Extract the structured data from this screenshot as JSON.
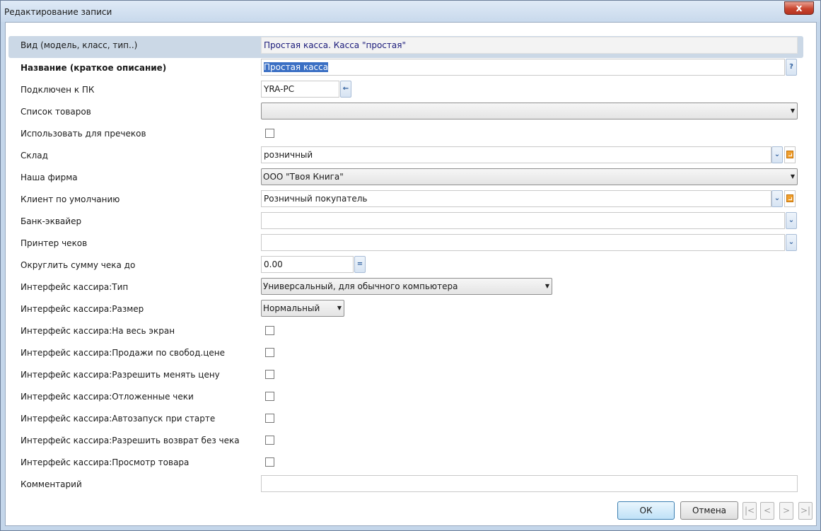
{
  "window": {
    "title": "Редактирование записи",
    "close_symbol": "x"
  },
  "fields": {
    "kind": {
      "label": "Вид (модель, класс, тип..)",
      "value": "Простая касса. Касса \"простая\""
    },
    "name": {
      "label": "Название (краткое описание)",
      "value": "Простая касса",
      "help_symbol": "?"
    },
    "connected_pc": {
      "label": "Подключен к ПК",
      "value": "YRA-PC",
      "button_symbol": "←"
    },
    "goods_list": {
      "label": "Список товаров",
      "value": ""
    },
    "use_for_prechecks": {
      "label": "Использовать для пречеков",
      "checked": false
    },
    "warehouse": {
      "label": "Склад",
      "value": "розничный"
    },
    "our_company": {
      "label": "Наша фирма",
      "value": "ООО \"Твоя Книга\""
    },
    "default_client": {
      "label": "Клиент по умолчанию",
      "value": "Розничный покупатель"
    },
    "acquiring_bank": {
      "label": "Банк-эквайер",
      "value": ""
    },
    "receipt_printer": {
      "label": "Принтер чеков",
      "value": ""
    },
    "round_sum": {
      "label": "Округлить сумму чека до",
      "value": "0.00",
      "button_symbol": "="
    },
    "cashier_type": {
      "label": "Интерфейс кассира:Тип",
      "value": "Универсальный, для обычного компьютера"
    },
    "cashier_size": {
      "label": "Интерфейс кассира:Размер",
      "value": "Нормальный"
    },
    "comment": {
      "label": "Комментарий",
      "value": ""
    }
  },
  "checkboxes": [
    {
      "label": "Интерфейс кассира:На весь экран",
      "checked": false
    },
    {
      "label": "Интерфейс кассира:Продажи по свобод.цене",
      "checked": false
    },
    {
      "label": "Интерфейс кассира:Разрешить менять цену",
      "checked": false
    },
    {
      "label": "Интерфейс кассира:Отложенные чеки",
      "checked": false
    },
    {
      "label": "Интерфейс кассира:Автозапуск при старте",
      "checked": false
    },
    {
      "label": "Интерфейс кассира:Разрешить возврат без чека",
      "checked": false
    },
    {
      "label": "Интерфейс кассира:Просмотр товара",
      "checked": false
    }
  ],
  "buttons": {
    "ok": "ОК",
    "cancel": "Отмена",
    "nav_first": "|<",
    "nav_prev": "<",
    "nav_next": ">",
    "nav_last": ">|"
  },
  "colors": {
    "accent": "#3a6fc4",
    "highlight_row": "#cbd8e6",
    "window_frame": "#c4d6ea"
  }
}
